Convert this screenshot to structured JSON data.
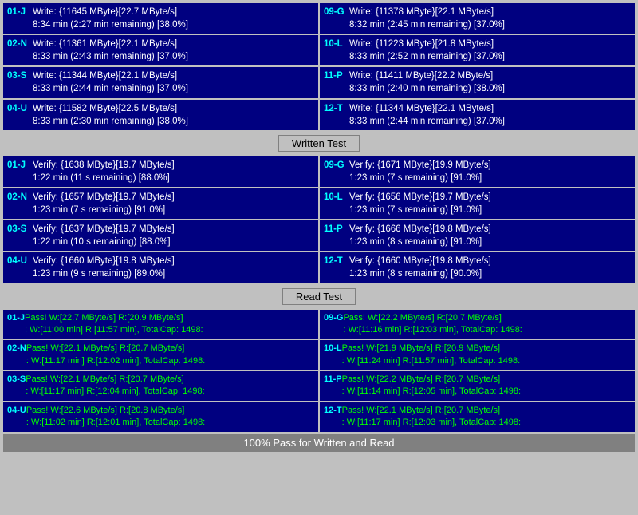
{
  "write_section": {
    "rows": [
      {
        "left": {
          "id": "01-J",
          "line1": "Write: {11645 MByte}[22.7 MByte/s]",
          "line2": "8:34 min (2:27 min remaining)  [38.0%]"
        },
        "right": {
          "id": "09-G",
          "line1": "Write: {11378 MByte}[22.1 MByte/s]",
          "line2": "8:32 min (2:45 min remaining)  [37.0%]"
        }
      },
      {
        "left": {
          "id": "02-N",
          "line1": "Write: {11361 MByte}[22.1 MByte/s]",
          "line2": "8:33 min (2:43 min remaining)  [37.0%]"
        },
        "right": {
          "id": "10-L",
          "line1": "Write: {11223 MByte}[21.8 MByte/s]",
          "line2": "8:33 min (2:52 min remaining)  [37.0%]"
        }
      },
      {
        "left": {
          "id": "03-S",
          "line1": "Write: {11344 MByte}[22.1 MByte/s]",
          "line2": "8:33 min (2:44 min remaining)  [37.0%]"
        },
        "right": {
          "id": "11-P",
          "line1": "Write: {11411 MByte}[22.2 MByte/s]",
          "line2": "8:33 min (2:40 min remaining)  [38.0%]"
        }
      },
      {
        "left": {
          "id": "04-U",
          "line1": "Write: {11582 MByte}[22.5 MByte/s]",
          "line2": "8:33 min (2:30 min remaining)  [38.0%]"
        },
        "right": {
          "id": "12-T",
          "line1": "Write: {11344 MByte}[22.1 MByte/s]",
          "line2": "8:33 min (2:44 min remaining)  [37.0%]"
        }
      }
    ],
    "divider": "Written Test"
  },
  "verify_section": {
    "rows": [
      {
        "left": {
          "id": "01-J",
          "line1": "Verify: {1638 MByte}[19.7 MByte/s]",
          "line2": "1:22 min (11 s remaining)   [88.0%]"
        },
        "right": {
          "id": "09-G",
          "line1": "Verify: {1671 MByte}[19.9 MByte/s]",
          "line2": "1:23 min (7 s remaining)   [91.0%]"
        }
      },
      {
        "left": {
          "id": "02-N",
          "line1": "Verify: {1657 MByte}[19.7 MByte/s]",
          "line2": "1:23 min (7 s remaining)   [91.0%]"
        },
        "right": {
          "id": "10-L",
          "line1": "Verify: {1656 MByte}[19.7 MByte/s]",
          "line2": "1:23 min (7 s remaining)   [91.0%]"
        }
      },
      {
        "left": {
          "id": "03-S",
          "line1": "Verify: {1637 MByte}[19.7 MByte/s]",
          "line2": "1:22 min (10 s remaining)   [88.0%]"
        },
        "right": {
          "id": "11-P",
          "line1": "Verify: {1666 MByte}[19.8 MByte/s]",
          "line2": "1:23 min (8 s remaining)   [91.0%]"
        }
      },
      {
        "left": {
          "id": "04-U",
          "line1": "Verify: {1660 MByte}[19.8 MByte/s]",
          "line2": "1:23 min (9 s remaining)   [89.0%]"
        },
        "right": {
          "id": "12-T",
          "line1": "Verify: {1660 MByte}[19.8 MByte/s]",
          "line2": "1:23 min (8 s remaining)   [90.0%]"
        }
      }
    ],
    "divider": "Read Test"
  },
  "read_section": {
    "rows": [
      {
        "left": {
          "id": "01-J",
          "line1": "Pass! W:[22.7 MByte/s] R:[20.9 MByte/s]",
          "line2": ": W:[11:00 min] R:[11:57 min], TotalCap: 1498:"
        },
        "right": {
          "id": "09-G",
          "line1": "Pass! W:[22.2 MByte/s] R:[20.7 MByte/s]",
          "line2": ": W:[11:16 min] R:[12:03 min], TotalCap: 1498:"
        }
      },
      {
        "left": {
          "id": "02-N",
          "line1": "Pass! W:[22.1 MByte/s] R:[20.7 MByte/s]",
          "line2": ": W:[11:17 min] R:[12:02 min], TotalCap: 1498:"
        },
        "right": {
          "id": "10-L",
          "line1": "Pass! W:[21.9 MByte/s] R:[20.9 MByte/s]",
          "line2": ": W:[11:24 min] R:[11:57 min], TotalCap: 1498:"
        }
      },
      {
        "left": {
          "id": "03-S",
          "line1": "Pass! W:[22.1 MByte/s] R:[20.7 MByte/s]",
          "line2": ": W:[11:17 min] R:[12:04 min], TotalCap: 1498:"
        },
        "right": {
          "id": "11-P",
          "line1": "Pass! W:[22.2 MByte/s] R:[20.7 MByte/s]",
          "line2": ": W:[11:14 min] R:[12:05 min], TotalCap: 1498:"
        }
      },
      {
        "left": {
          "id": "04-U",
          "line1": "Pass! W:[22.6 MByte/s] R:[20.8 MByte/s]",
          "line2": ": W:[11:02 min] R:[12:01 min], TotalCap: 1498:"
        },
        "right": {
          "id": "12-T",
          "line1": "Pass! W:[22.1 MByte/s] R:[20.7 MByte/s]",
          "line2": ": W:[11:17 min] R:[12:03 min], TotalCap: 1498:"
        }
      }
    ]
  },
  "bottom_status": "100% Pass for Written and Read"
}
